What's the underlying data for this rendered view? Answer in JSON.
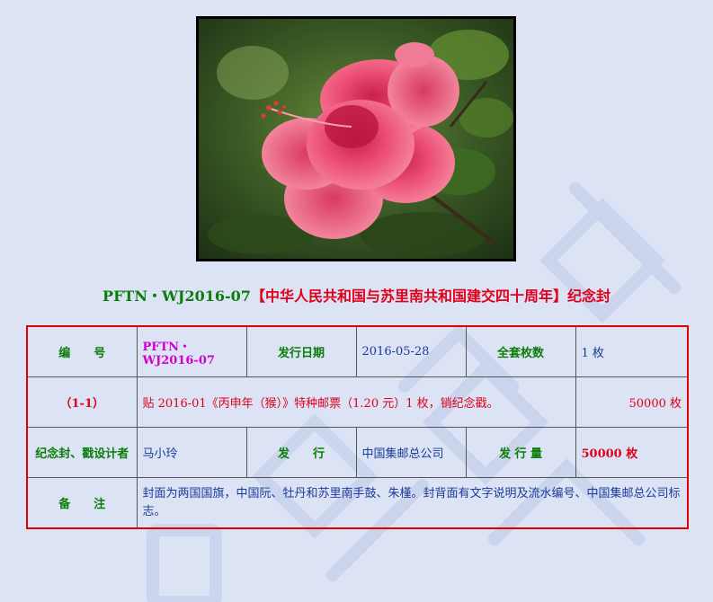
{
  "colors": {
    "page_bg": "#dce3f4",
    "green_label": "#0b7d0b",
    "red_text": "#e0001b",
    "blue_value": "#1a3a9a",
    "magenta_code": "#d100d1",
    "table_border": "#e00000"
  },
  "image": {
    "subject": "pink hibiscus flower photo"
  },
  "title": {
    "code": "PFTN・WJ2016-07",
    "name": "【中华人民共和国与苏里南共和国建交四十周年】",
    "suffix": "纪念封"
  },
  "table": {
    "row1": {
      "number_label": "编　　号",
      "number_value": "PFTN・WJ2016-07",
      "date_label": "发行日期",
      "date_value": "2016-05-28",
      "set_label": "全套枚数",
      "set_value": "1 枚"
    },
    "row2": {
      "item_label": "（1-1）",
      "item_desc": "贴 2016-01《丙申年（猴）》特种邮票（1.20 元）1 枚，销纪念戳。",
      "item_qty": "50000 枚"
    },
    "row3": {
      "designer_label": "纪念封、戳设计者",
      "designer_value": "马小玲",
      "issuer_label": "发　　行",
      "issuer_value": "中国集邮总公司",
      "volume_label": "发 行 量",
      "volume_value": "50000 枚"
    },
    "row4": {
      "remark_label": "备　　注",
      "remark_value": "封面为两国国旗，中国阮、牡丹和苏里南手鼓、朱槿。封背面有文字说明及流水编号、中国集邮总公司标志。"
    }
  }
}
